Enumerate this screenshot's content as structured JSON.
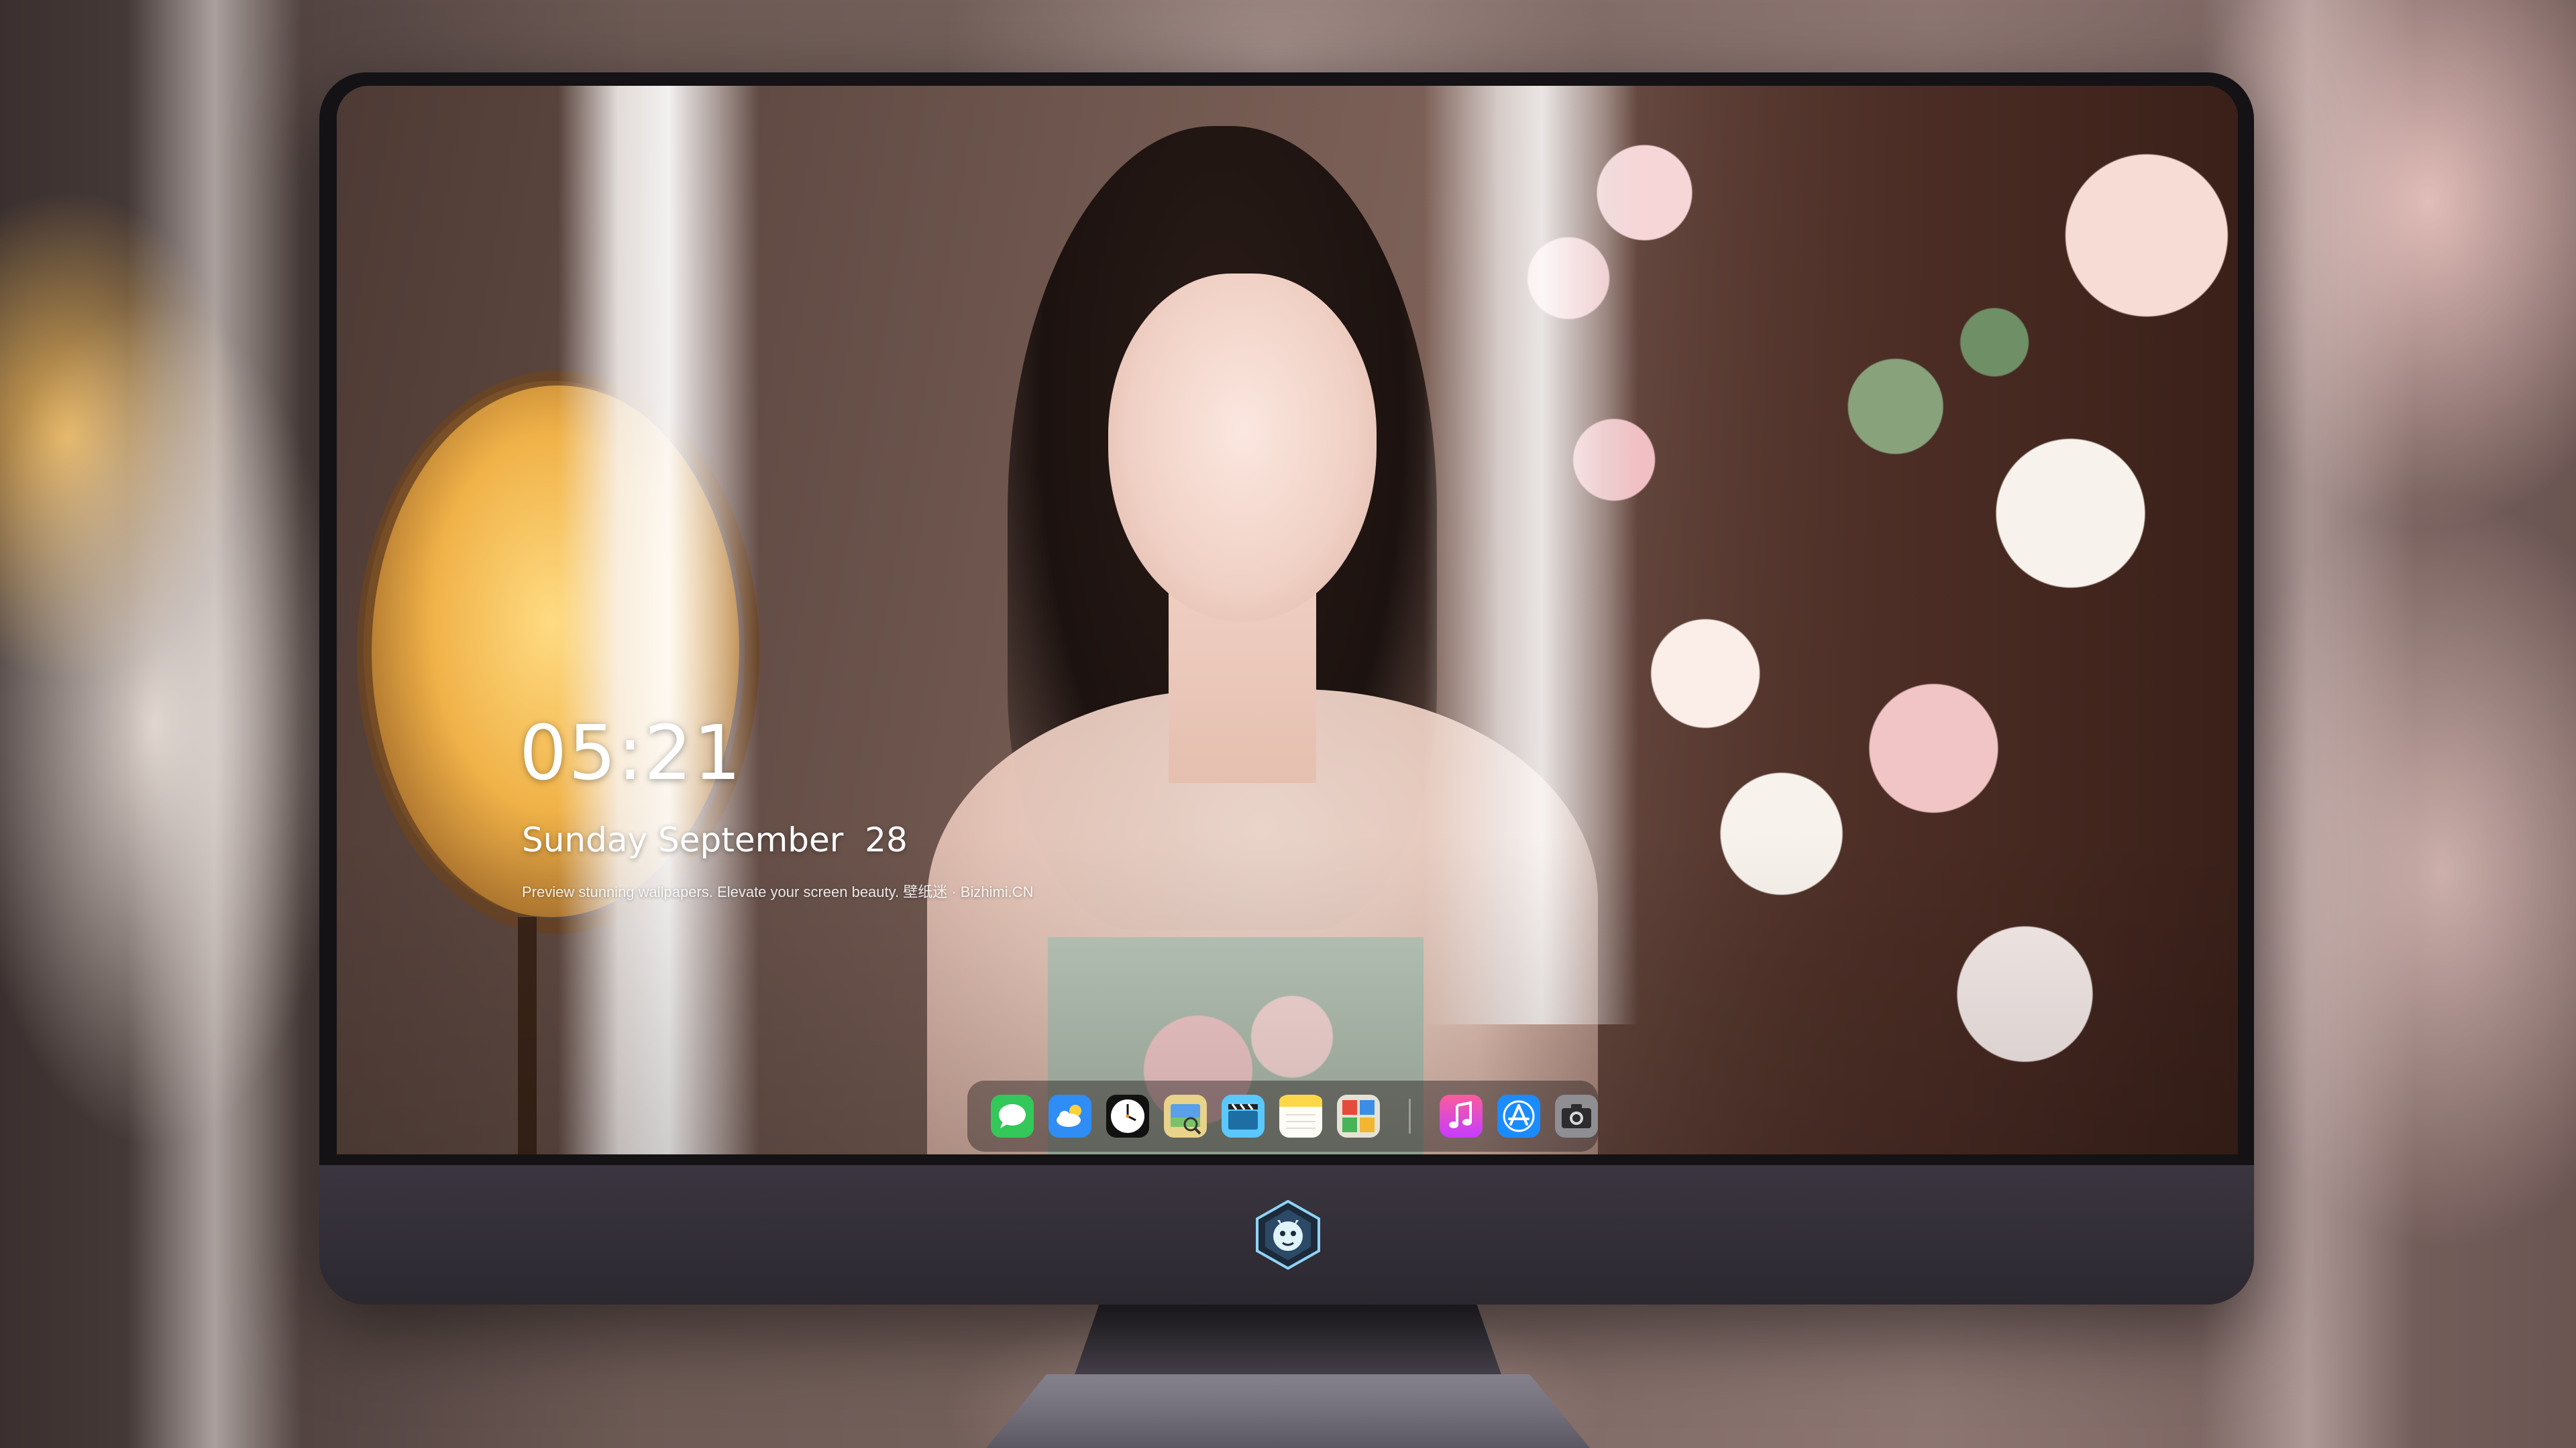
{
  "lock_screen": {
    "time": "05:21",
    "date": "Sunday September  28",
    "tagline": "Preview stunning wallpapers. Elevate your screen beauty. 壁纸迷 · Bizhimi.CN"
  },
  "dock": {
    "apps": [
      {
        "name": "Messages",
        "icon": "messages-icon",
        "color": "#34c759"
      },
      {
        "name": "Weather",
        "icon": "weather-icon",
        "color": "#2f8df5"
      },
      {
        "name": "Clock",
        "icon": "clock-icon",
        "color": "#111111"
      },
      {
        "name": "Preview",
        "icon": "preview-icon",
        "color": "#e9d28a"
      },
      {
        "name": "Clips",
        "icon": "clips-icon",
        "color": "#5ac8fa"
      },
      {
        "name": "Notes",
        "icon": "notes-icon",
        "color": "#ffd84a"
      },
      {
        "name": "Photo Booth",
        "icon": "photo-booth-icon",
        "color": "#e0c060"
      },
      {
        "name": "Music",
        "icon": "music-icon",
        "color": "#fc3c8d"
      },
      {
        "name": "App Store",
        "icon": "app-store-icon",
        "color": "#1a8cff"
      },
      {
        "name": "Camera",
        "icon": "camera-icon",
        "color": "#8e8e93"
      }
    ]
  },
  "device": {
    "chin_logo": "dragon-logo-icon"
  }
}
